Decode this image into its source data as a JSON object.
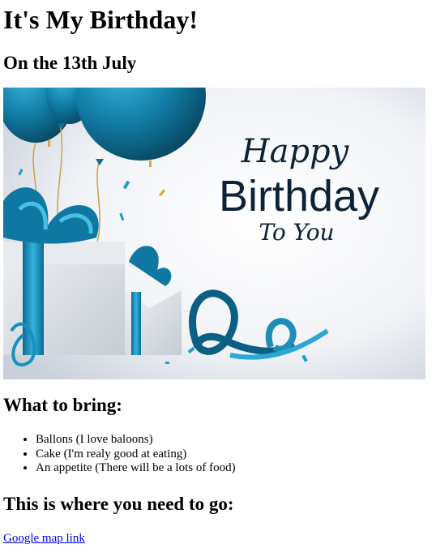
{
  "page": {
    "title": "It's My Birthday!",
    "date_heading": "On the 13th July"
  },
  "banner": {
    "line1": "Happy",
    "line2": "Birthday",
    "line3": "To You",
    "colors": {
      "accent": "#1b8fb8",
      "dark_teal": "#0a5a7a",
      "text_navy": "#0e2236",
      "box": "#dfe3e8",
      "background": "#f2f4f8"
    }
  },
  "bring": {
    "heading": "What to bring:",
    "items": [
      "Ballons (I love baloons)",
      "Cake (I'm realy good at eating)",
      "An appetite (There will be a lots of food)"
    ]
  },
  "directions": {
    "heading": "This is where you need to go:",
    "link_text": "Google map link"
  }
}
